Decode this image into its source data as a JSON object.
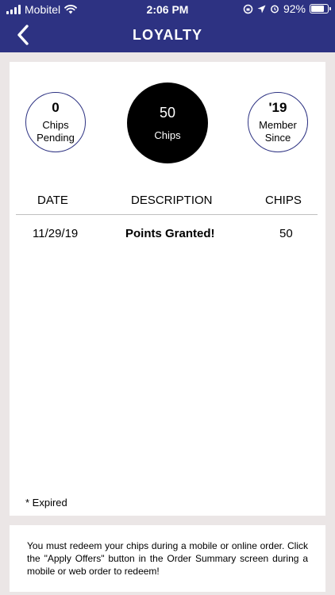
{
  "status_bar": {
    "carrier": "Mobitel",
    "time": "2:06 PM",
    "battery": "92%",
    "battery_level": 0.92
  },
  "nav": {
    "title": "LOYALTY",
    "back_icon": "chevron-left-icon"
  },
  "colors": {
    "brand": "#2d3282",
    "background": "#ebe6e6",
    "card": "#ffffff"
  },
  "summary": {
    "pending": {
      "value": "0",
      "label": "Chips\nPending"
    },
    "chips": {
      "value": "50",
      "label": "Chips"
    },
    "member": {
      "value": "'19",
      "label": "Member\nSince"
    }
  },
  "table": {
    "headers": {
      "date": "DATE",
      "description": "DESCRIPTION",
      "chips": "CHIPS"
    },
    "rows": [
      {
        "date": "11/29/19",
        "description": "Points Granted!",
        "chips": "50"
      }
    ]
  },
  "footnote": "* Expired",
  "info_text": "You must redeem your chips during a mobile or online order. Click the \"Apply Offers\" button in the Order Summary screen during a mobile or web order to redeem!"
}
